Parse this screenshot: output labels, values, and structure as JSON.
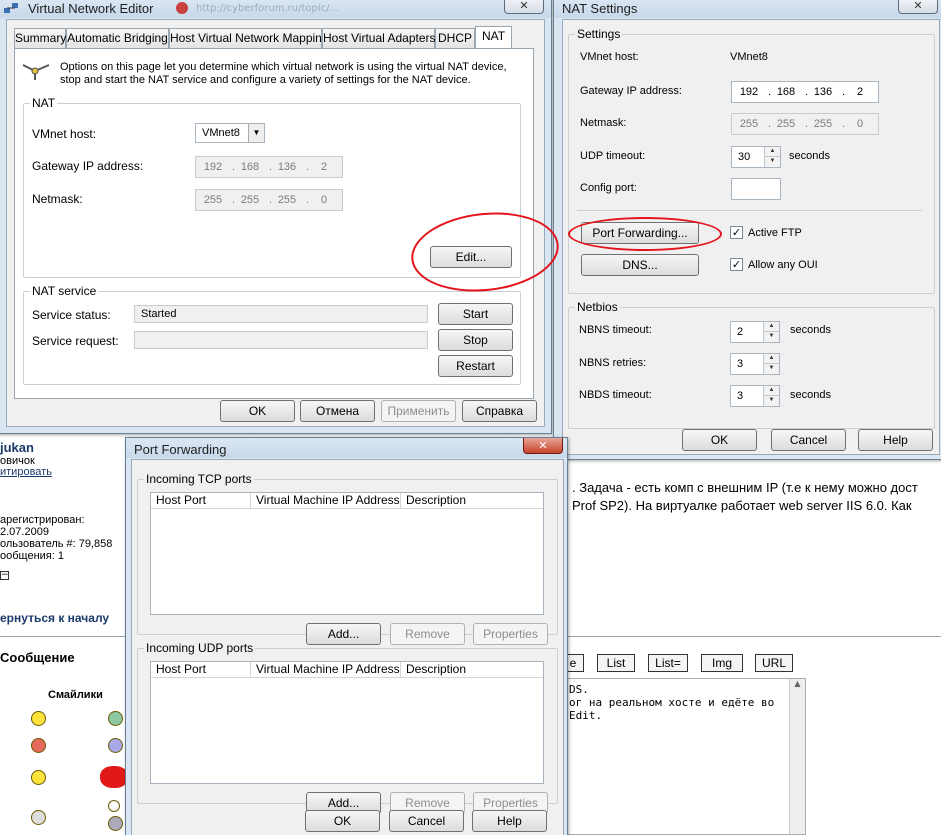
{
  "forum": {
    "user_name": "jukan",
    "user_rank": "овичок",
    "quote_link": "итировать",
    "registered_label": "арегистрирован:",
    "registered_date": "2.07.2009",
    "user_id": "ользователь #: 79,858",
    "posts": "ообщения: 1",
    "back_to_top": "ернуться к началу",
    "message_heading": "Сообщение",
    "smilies_heading": "Смайлики",
    "post_line1": ". Задача - есть комп с внешним IP (т.е к нему можно дост",
    "post_line2": "Prof SP2). На виртуалке работает web server IIS 6.0. Как",
    "tag_buttons": [
      "e",
      "List",
      "List=",
      "Img",
      "URL"
    ],
    "textarea_lines": [
      "DS.",
      "ог на реальном хосте и едёте во",
      "Edit."
    ]
  },
  "vne": {
    "title": "Virtual Network Editor",
    "browser_tab_text": "http://cyberforum.ru/topic/...",
    "tabs": [
      "Summary",
      "Automatic Bridging",
      "Host Virtual Network Mapping",
      "Host Virtual Adapters",
      "DHCP",
      "NAT"
    ],
    "info_line1": "Options on this page let you determine which virtual network is using the virtual NAT device,",
    "info_line2": "stop and start the NAT service and configure a variety of settings for the NAT device.",
    "nat_group": "NAT",
    "vmnet_host_label": "VMnet host:",
    "vmnet_host_value": "VMnet8",
    "gateway_label": "Gateway IP address:",
    "gateway_ip": [
      "192",
      "168",
      "136",
      "2"
    ],
    "netmask_label": "Netmask:",
    "netmask": [
      "255",
      "255",
      "255",
      "0"
    ],
    "edit_button": "Edit...",
    "service_group": "NAT service",
    "service_status_label": "Service status:",
    "service_status_value": "Started",
    "service_request_label": "Service request:",
    "start_button": "Start",
    "stop_button": "Stop",
    "restart_button": "Restart",
    "ok_button": "OK",
    "cancel_button": "Отмена",
    "apply_button": "Применить",
    "help_button": "Справка"
  },
  "nat": {
    "title": "NAT Settings",
    "settings_group": "Settings",
    "vmnet_host_label": "VMnet host:",
    "vmnet_host_value": "VMnet8",
    "gateway_label": "Gateway IP address:",
    "gateway_ip": [
      "192",
      "168",
      "136",
      "2"
    ],
    "netmask_label": "Netmask:",
    "netmask": [
      "255",
      "255",
      "255",
      "0"
    ],
    "udp_label": "UDP timeout:",
    "udp_value": "30",
    "seconds": "seconds",
    "config_port_label": "Config port:",
    "config_port_value": "",
    "port_forwarding_button": "Port Forwarding...",
    "dns_button": "DNS...",
    "active_ftp_label": "Active FTP",
    "allow_oui_label": "Allow any OUI",
    "netbios_group": "Netbios",
    "nbns_timeout_label": "NBNS timeout:",
    "nbns_timeout_value": "2",
    "nbns_retries_label": "NBNS retries:",
    "nbns_retries_value": "3",
    "nbds_timeout_label": "NBDS timeout:",
    "nbds_timeout_value": "3",
    "ok_button": "OK",
    "cancel_button": "Cancel",
    "help_button": "Help"
  },
  "pf": {
    "title": "Port Forwarding",
    "tcp_group": "Incoming TCP ports",
    "udp_group": "Incoming UDP ports",
    "columns": [
      "Host Port",
      "Virtual Machine IP Address",
      "Description"
    ],
    "add_button": "Add...",
    "remove_button": "Remove",
    "properties_button": "Properties",
    "ok_button": "OK",
    "cancel_button": "Cancel",
    "help_button": "Help"
  },
  "colors": {
    "annotation_red": "#e3141b",
    "window_frame": "#d9e6f2",
    "dialog_face": "#f0f0f0"
  }
}
